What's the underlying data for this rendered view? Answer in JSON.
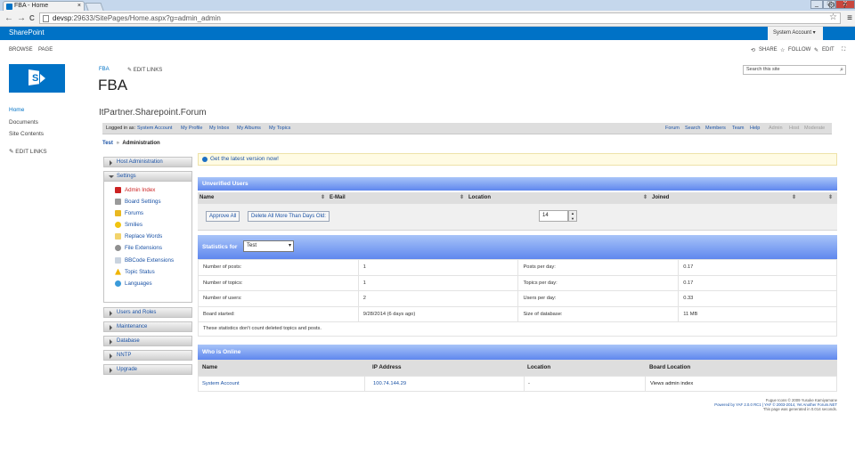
{
  "browser": {
    "tab_title": "FBA - Home",
    "tab_close": "×",
    "url_host": "devsp",
    "url_rest": ":29633/SitePages/Home.aspx?g=admin_admin",
    "back": "←",
    "forward": "→",
    "reload": "C",
    "star": "☆",
    "menu": "≡",
    "minimize": "_",
    "maximize": "□",
    "close": "X"
  },
  "suitebar": {
    "brand": "SharePoint",
    "account": "System Account ▾",
    "gear": "⚙",
    "help": "?"
  },
  "ribbon": {
    "browse": "BROWSE",
    "page": "PAGE",
    "share": "SHARE",
    "follow": "FOLLOW",
    "edit": "EDIT"
  },
  "site": {
    "crumb": "FBA",
    "edit_links": "EDIT LINKS",
    "title": "FBA",
    "search_placeholder": "Search this site",
    "forum_title": "ItPartner.Sharepoint.Forum"
  },
  "left_nav": {
    "items": [
      "Home",
      "Documents",
      "Site Contents"
    ],
    "edit_links": "EDIT LINKS"
  },
  "forum_bar": {
    "logged_in_as": "Logged in as:",
    "user": "System Account",
    "left_links": [
      "My Profile",
      "My Inbox",
      "My Albums",
      "My Topics"
    ],
    "right_links": [
      "Forum",
      "Search",
      "Members",
      "Team",
      "Help"
    ],
    "admin_links": [
      "Admin",
      "Host",
      "Moderate"
    ]
  },
  "yaf_crumb": {
    "root": "Test",
    "sep": "»",
    "current": "Administration"
  },
  "admin_menu": {
    "host": "Host Administration",
    "settings": "Settings",
    "settings_items": [
      {
        "label": "Admin Index",
        "icon": "admin-index-icon",
        "color": "#cc2222"
      },
      {
        "label": "Board Settings",
        "icon": "board-settings-icon",
        "color": "#1a52a5"
      },
      {
        "label": "Forums",
        "icon": "forums-icon",
        "color": "#1a52a5"
      },
      {
        "label": "Smilies",
        "icon": "smilies-icon",
        "color": "#1a52a5"
      },
      {
        "label": "Replace Words",
        "icon": "replace-words-icon",
        "color": "#1a52a5"
      },
      {
        "label": "File Extensions",
        "icon": "file-extensions-icon",
        "color": "#1a52a5"
      },
      {
        "label": "BBCode Extensions",
        "icon": "bbcode-extensions-icon",
        "color": "#1a52a5"
      },
      {
        "label": "Topic Status",
        "icon": "topic-status-icon",
        "color": "#1a52a5"
      },
      {
        "label": "Languages",
        "icon": "languages-icon",
        "color": "#1a52a5"
      }
    ],
    "sections": [
      "Users and Roles",
      "Maintenance",
      "Database",
      "NNTP",
      "Upgrade"
    ]
  },
  "notice": "Get the latest version now!",
  "unverified": {
    "title": "Unverified Users",
    "columns": [
      "Name",
      "E-Mail",
      "Location",
      "Joined"
    ],
    "sort_glyph": "⬍",
    "approve_all": "Approve All",
    "delete_older": "Delete All More Than Days Old:",
    "days": "14"
  },
  "statistics": {
    "title": "Statistics for",
    "board": "Test",
    "rows": [
      [
        "Number of posts:",
        "1",
        "Posts per day:",
        "0.17"
      ],
      [
        "Number of topics:",
        "1",
        "Topics per day:",
        "0.17"
      ],
      [
        "Number of users:",
        "2",
        "Users per day:",
        "0.33"
      ],
      [
        "Board started:",
        "9/28/2014 (6 days ago)",
        "Size of database:",
        "11 MB"
      ]
    ],
    "note": "These statistics don't count deleted topics and posts."
  },
  "who_online": {
    "title": "Who is Online",
    "columns": [
      "Name",
      "IP Address",
      "Location",
      "Board Location"
    ],
    "row": [
      "System Account",
      "100.74.144.29",
      "-",
      "Views admin index"
    ]
  },
  "footer": {
    "line1": "Fugue Icons © 2009 Yusuke Kamiyamane",
    "line2": "Powered by YAF 2.0.0 RC1 | YAF © 2003-2014, Yet Another Forum.NET",
    "line3": "This page was generated in 0.014 seconds."
  }
}
